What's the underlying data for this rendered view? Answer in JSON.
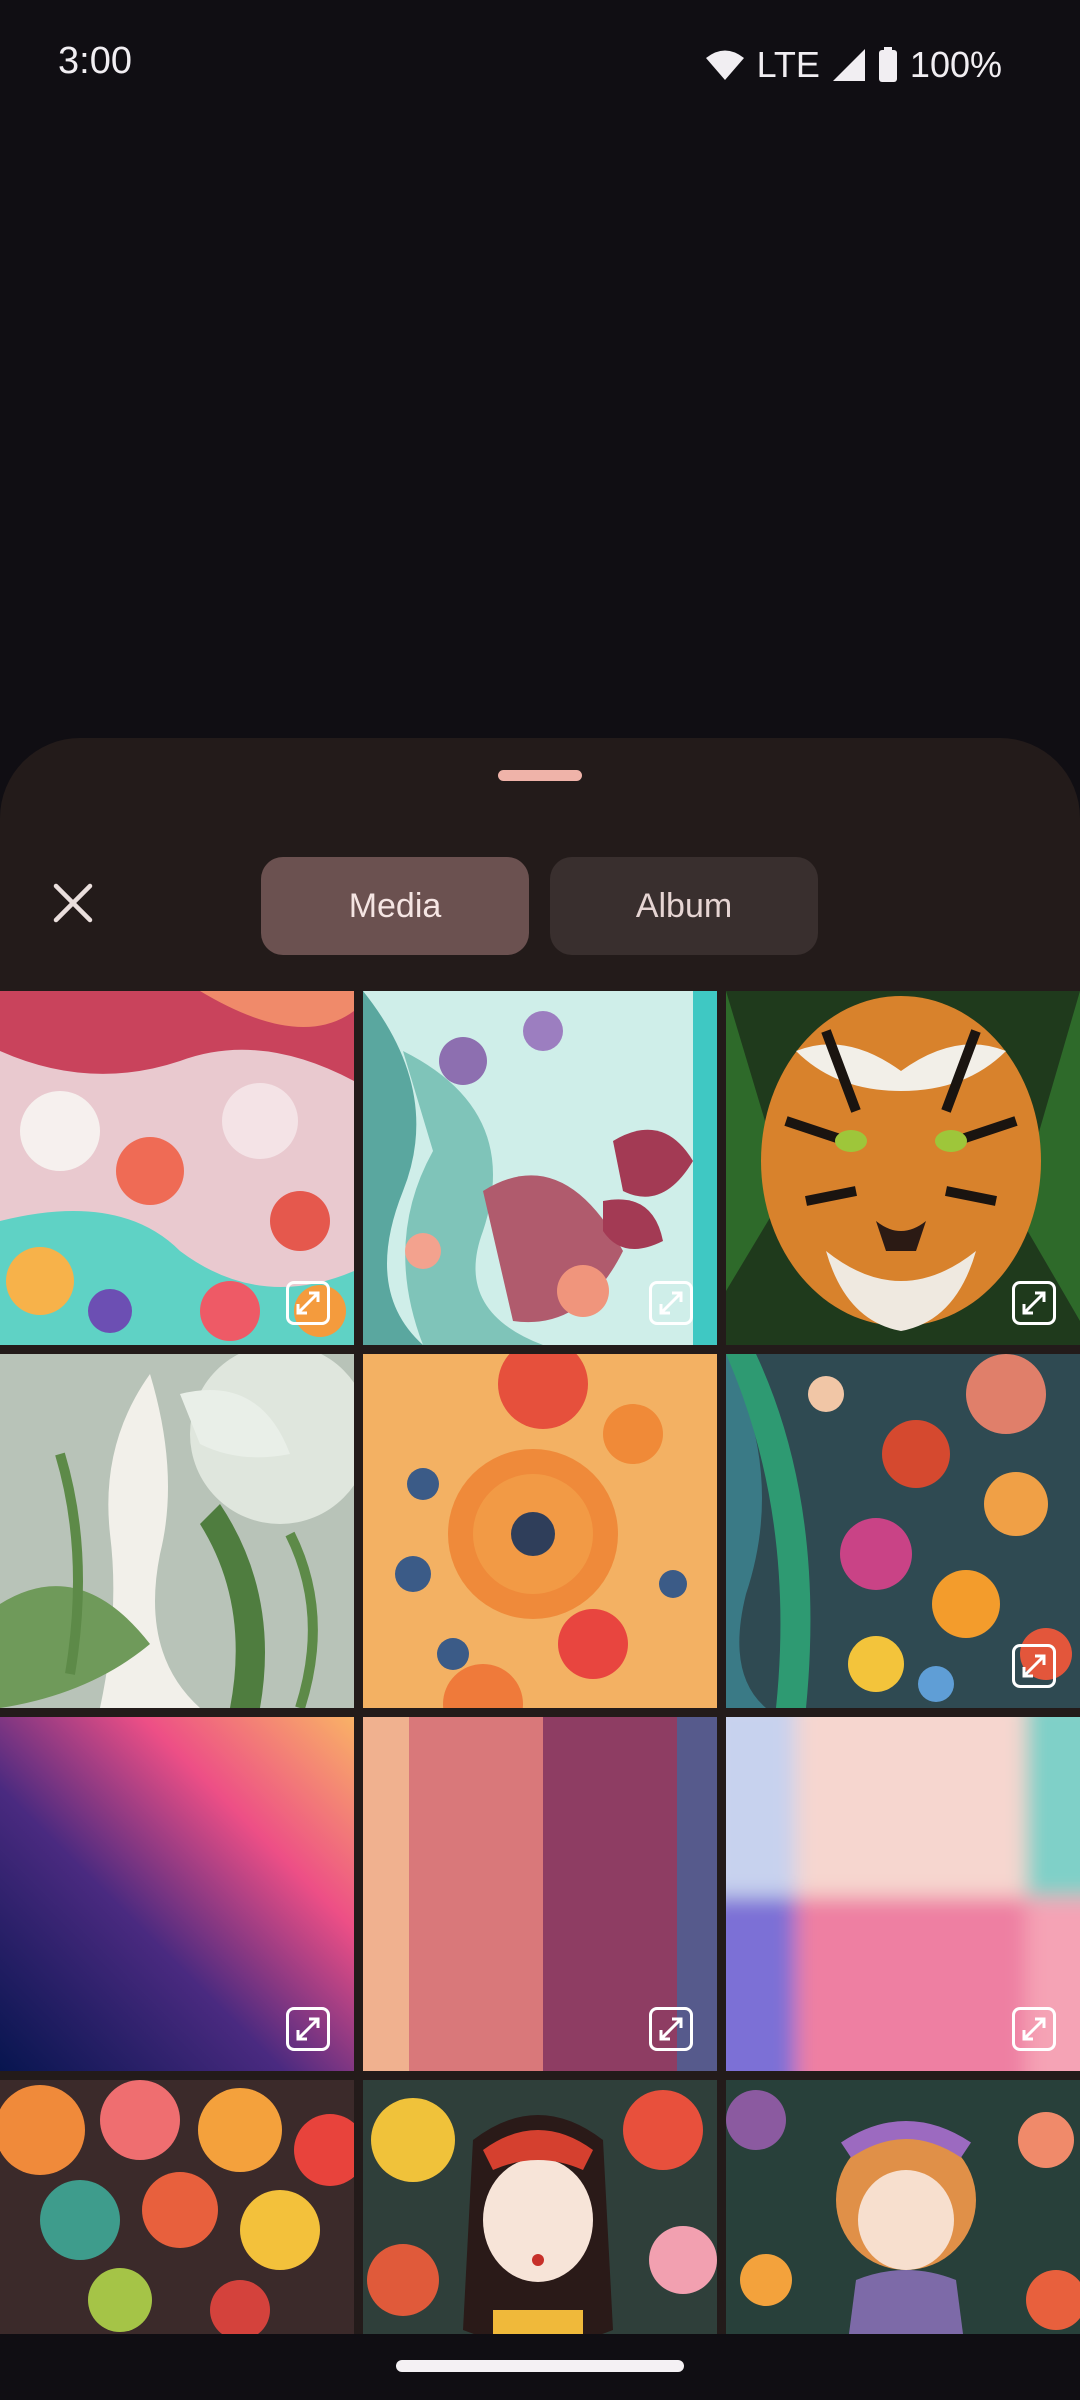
{
  "status_bar": {
    "time": "3:00",
    "network": "LTE",
    "battery": "100%",
    "icons": [
      "wifi-icon",
      "cell-signal-icon",
      "battery-icon"
    ]
  },
  "sheet": {
    "close_icon": "close-icon",
    "tabs": [
      {
        "label": "Media",
        "active": true
      },
      {
        "label": "Album",
        "active": false
      }
    ]
  },
  "grid": {
    "items": [
      {
        "name": "candy-landscape",
        "expand_icon": true
      },
      {
        "name": "paper-butterflies",
        "expand_icon": true
      },
      {
        "name": "tiger",
        "expand_icon": true
      },
      {
        "name": "fairy",
        "expand_icon": false
      },
      {
        "name": "paper-poppies",
        "expand_icon": false
      },
      {
        "name": "paper-flowers-wave",
        "expand_icon": true
      },
      {
        "name": "gradient-pink-blue",
        "expand_icon": true
      },
      {
        "name": "stripes-peach-rose",
        "expand_icon": true
      },
      {
        "name": "blurred-blocks",
        "expand_icon": true
      },
      {
        "name": "flower-bouquet",
        "expand_icon": false
      },
      {
        "name": "paper-girl",
        "expand_icon": false
      },
      {
        "name": "flower-doll",
        "expand_icon": false
      }
    ]
  },
  "colors": {
    "background": "#100e13",
    "sheet": "#231b1a",
    "tab_active": "#6b5150",
    "tab_inactive": "#392f2e",
    "handle": "#efb3a9"
  }
}
